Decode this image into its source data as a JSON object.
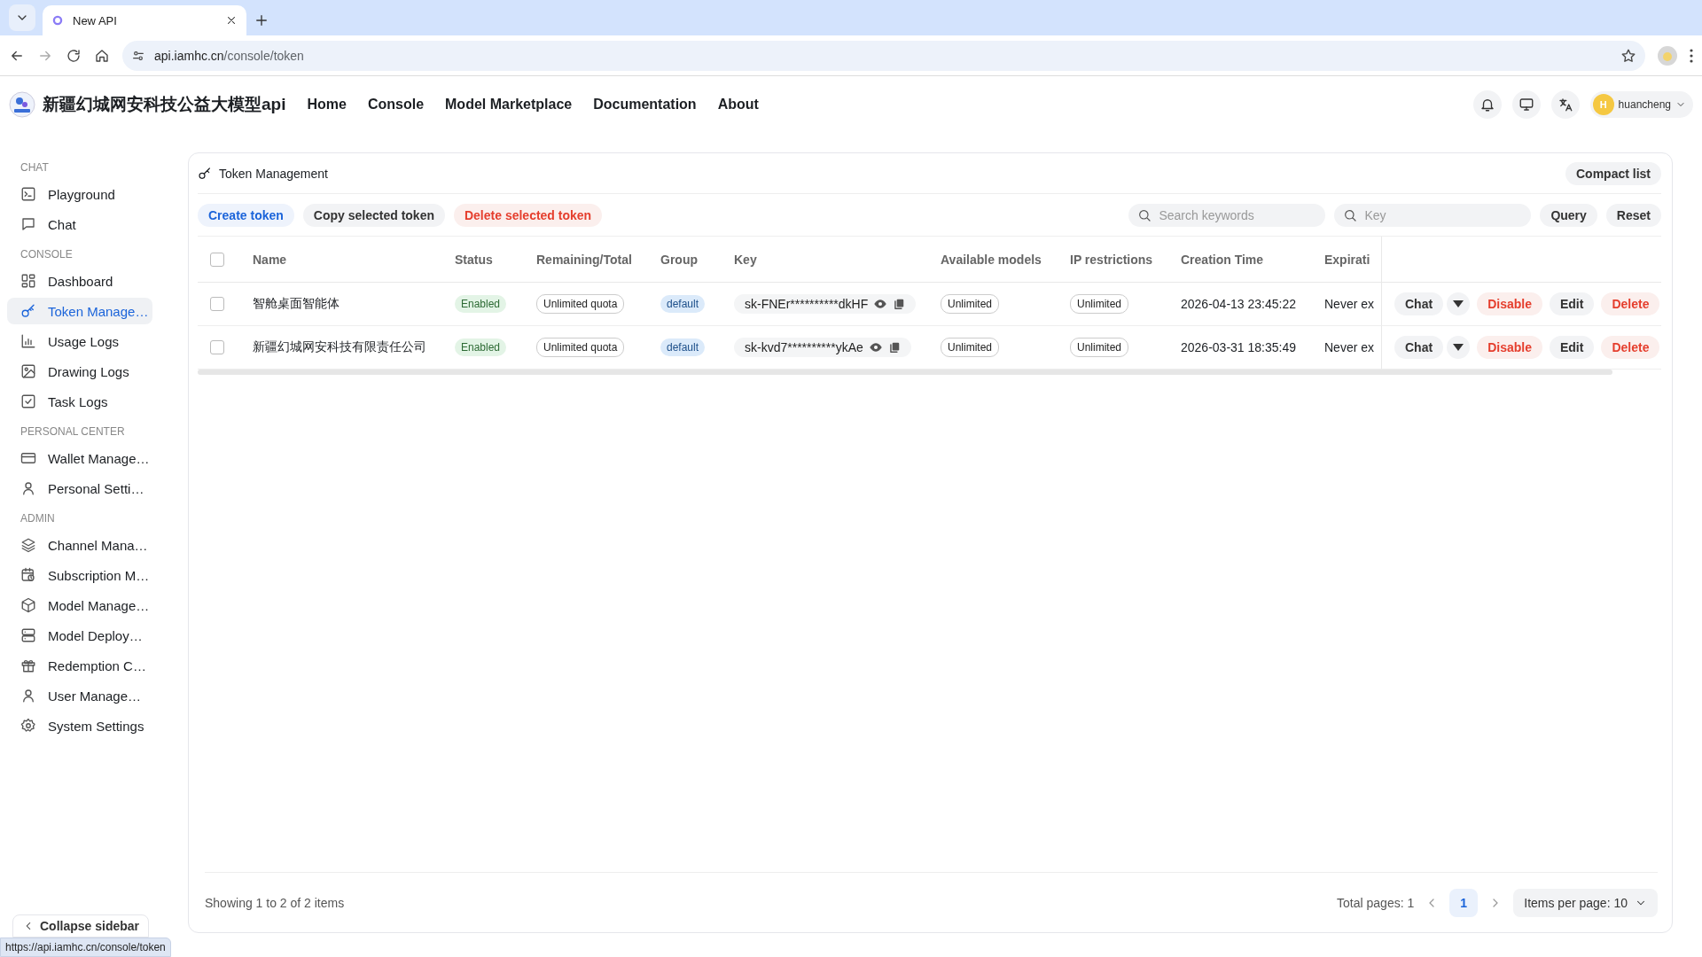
{
  "browser": {
    "tab_title": "New API",
    "url_host": "api.iamhc.cn",
    "url_path": "/console/token"
  },
  "header": {
    "site_name": "新疆幻城网安科技公益大模型api",
    "nav": [
      {
        "label": "Home"
      },
      {
        "label": "Console"
      },
      {
        "label": "Model Marketplace"
      },
      {
        "label": "Documentation"
      },
      {
        "label": "About"
      }
    ],
    "user": {
      "initial": "H",
      "name": "huancheng"
    }
  },
  "sidebar": {
    "sections": [
      {
        "title": "CHAT",
        "items": [
          {
            "label": "Playground",
            "selected": false
          },
          {
            "label": "Chat",
            "selected": false
          }
        ]
      },
      {
        "title": "CONSOLE",
        "items": [
          {
            "label": "Dashboard",
            "selected": false
          },
          {
            "label": "Token Manage…",
            "selected": true
          },
          {
            "label": "Usage Logs",
            "selected": false
          },
          {
            "label": "Drawing Logs",
            "selected": false
          },
          {
            "label": "Task Logs",
            "selected": false
          }
        ]
      },
      {
        "title": "PERSONAL CENTER",
        "items": [
          {
            "label": "Wallet Manage…",
            "selected": false
          },
          {
            "label": "Personal Setti…",
            "selected": false
          }
        ]
      },
      {
        "title": "ADMIN",
        "items": [
          {
            "label": "Channel Mana…",
            "selected": false
          },
          {
            "label": "Subscription M…",
            "selected": false
          },
          {
            "label": "Model Manage…",
            "selected": false
          },
          {
            "label": "Model Deploy…",
            "selected": false
          },
          {
            "label": "Redemption C…",
            "selected": false
          },
          {
            "label": "User Manage…",
            "selected": false
          },
          {
            "label": "System Settings",
            "selected": false
          }
        ]
      }
    ],
    "collapse": "Collapse sidebar"
  },
  "panel": {
    "title": "Token Management",
    "compact_button": "Compact list",
    "actions": [
      {
        "label": "Create token",
        "kind": "primary"
      },
      {
        "label": "Copy selected token",
        "kind": "neutral"
      },
      {
        "label": "Delete selected token",
        "kind": "danger"
      }
    ],
    "search": {
      "placeholder": "Search keywords"
    },
    "key_search": {
      "placeholder": "Key"
    },
    "query_button": "Query",
    "reset_button": "Reset",
    "table": {
      "select_all_checked": false,
      "columns": [
        "Name",
        "Status",
        "Remaining/Total",
        "Group",
        "Key",
        "Available models",
        "IP restrictions",
        "Creation Time",
        "Expirati"
      ],
      "rows": [
        {
          "selected": false,
          "name": "智舱桌面智能体",
          "status": "Enabled",
          "quota": "Unlimited quota",
          "group": "default",
          "key": "sk-FNEr**********dkHF",
          "models": "Unlimited",
          "ip": "Unlimited",
          "created": "2026-04-13 23:45:22",
          "expiration": "Never ex",
          "actions": [
            {
              "label": "Chat",
              "kind": "split"
            },
            {
              "label": "Disable",
              "kind": "danger"
            },
            {
              "label": "Edit",
              "kind": "neutral"
            },
            {
              "label": "Delete",
              "kind": "danger"
            }
          ]
        },
        {
          "selected": false,
          "name": "新疆幻城网安科技有限责任公司",
          "status": "Enabled",
          "quota": "Unlimited quota",
          "group": "default",
          "key": "sk-kvd7**********ykAe",
          "models": "Unlimited",
          "ip": "Unlimited",
          "created": "2026-03-31 18:35:49",
          "expiration": "Never ex",
          "actions": [
            {
              "label": "Chat",
              "kind": "split"
            },
            {
              "label": "Disable",
              "kind": "danger"
            },
            {
              "label": "Edit",
              "kind": "neutral"
            },
            {
              "label": "Delete",
              "kind": "danger"
            }
          ]
        }
      ]
    },
    "footer": {
      "summary": "Showing 1 to 2 of 2 items",
      "total_pages": "Total pages: 1",
      "pages": [
        {
          "label": "1",
          "selected": true
        }
      ],
      "page_size": "Items per page: 10"
    }
  },
  "status_url": "https://api.iamhc.cn/console/token"
}
